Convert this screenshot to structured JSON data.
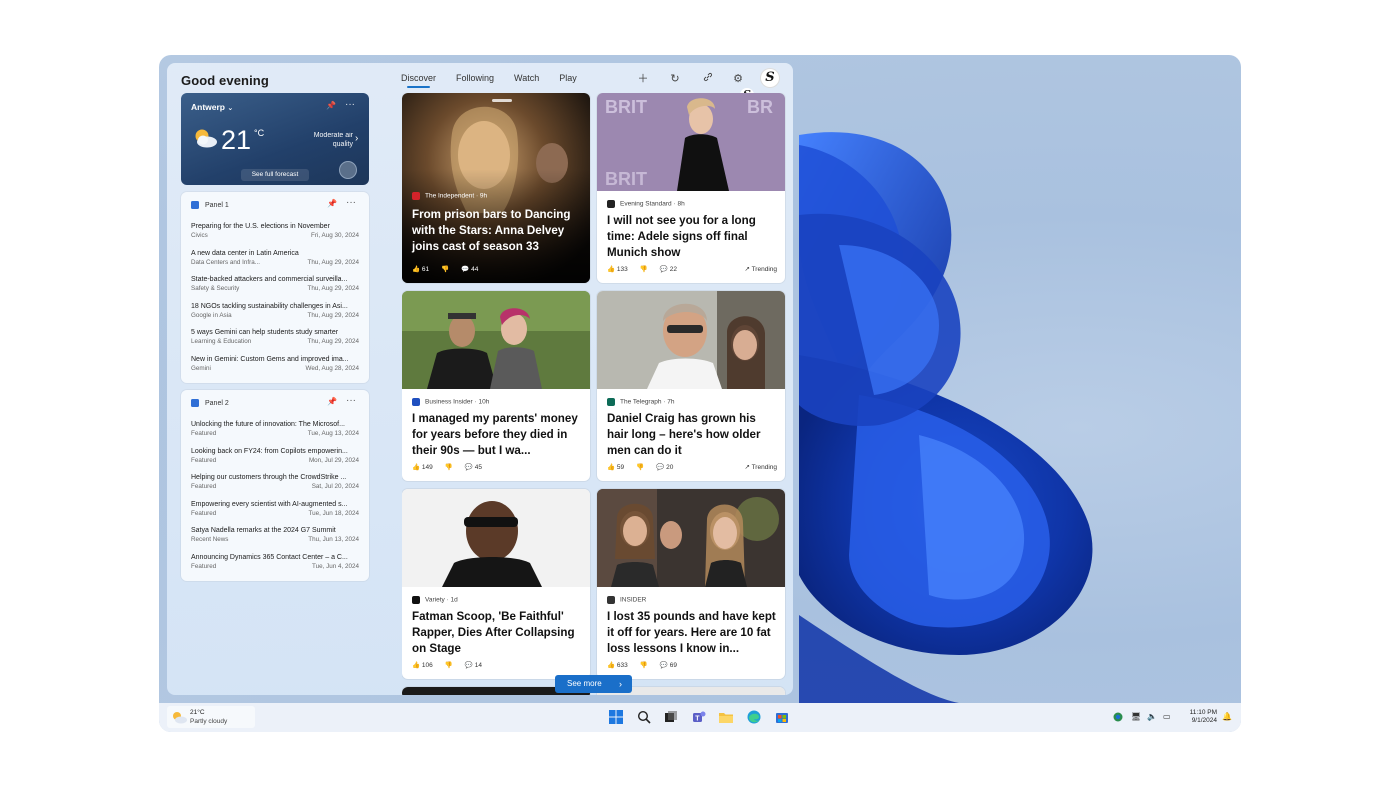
{
  "board": {
    "greeting": "Good evening",
    "tabs": [
      {
        "label": "Discover",
        "active": true
      },
      {
        "label": "Following",
        "active": false
      },
      {
        "label": "Watch",
        "active": false
      },
      {
        "label": "Play",
        "active": false
      }
    ],
    "avatar_letter": "S"
  },
  "weather": {
    "city": "Antwerp",
    "temp": "21",
    "unit": "°C",
    "air_quality": "Moderate air quality",
    "forecast_label": "See full forecast"
  },
  "panels": [
    {
      "title": "Panel 1",
      "items": [
        {
          "title": "Preparing for the U.S. elections in November",
          "category": "Civics",
          "date": "Fri, Aug 30, 2024"
        },
        {
          "title": "A new data center in Latin America",
          "category": "Data Centers and Infra...",
          "date": "Thu, Aug 29, 2024"
        },
        {
          "title": "State-backed attackers and commercial surveilla...",
          "category": "Safety & Security",
          "date": "Thu, Aug 29, 2024"
        },
        {
          "title": "18 NGOs tackling sustainability challenges in Asi...",
          "category": "Google in Asia",
          "date": "Thu, Aug 29, 2024"
        },
        {
          "title": "5 ways Gemini can help students study smarter",
          "category": "Learning & Education",
          "date": "Thu, Aug 29, 2024"
        },
        {
          "title": "New in Gemini: Custom Gems and improved ima...",
          "category": "Gemini",
          "date": "Wed, Aug 28, 2024"
        }
      ]
    },
    {
      "title": "Panel 2",
      "items": [
        {
          "title": "Unlocking the future of innovation: The Microsof...",
          "category": "Featured",
          "date": "Tue, Aug 13, 2024"
        },
        {
          "title": "Looking back on FY24: from Copilots empowerin...",
          "category": "Featured",
          "date": "Mon, Jul 29, 2024"
        },
        {
          "title": "Helping our customers through the CrowdStrike ...",
          "category": "Featured",
          "date": "Sat, Jul 20, 2024"
        },
        {
          "title": "Empowering every scientist with AI-augmented s...",
          "category": "Featured",
          "date": "Tue, Jun 18, 2024"
        },
        {
          "title": "Satya Nadella remarks at the 2024 G7 Summit",
          "category": "Recent News",
          "date": "Thu, Jun 13, 2024"
        },
        {
          "title": "Announcing Dynamics 365 Contact Center – a C...",
          "category": "Featured",
          "date": "Tue, Jun 4, 2024"
        }
      ]
    }
  ],
  "feed": [
    {
      "source": "The Independent · 9h",
      "title": "From prison bars to Dancing with the Stars: Anna Delvey joins cast of season 33",
      "likes": "61",
      "comments": "44",
      "trend": "",
      "icon_color": "#d2232a"
    },
    {
      "source": "Evening Standard · 8h",
      "title": "I will not see you for a long time: Adele signs off final Munich show",
      "likes": "133",
      "comments": "22",
      "trend": "Trending",
      "icon_color": "#222222"
    },
    {
      "source": "Business Insider · 10h",
      "title": "I managed my parents' money for years before they died in their 90s — but I wa...",
      "likes": "149",
      "comments": "45",
      "trend": "",
      "icon_color": "#1f4fbf"
    },
    {
      "source": "The Telegraph · 7h",
      "title": "Daniel Craig has grown his hair long – here's how older men can do it",
      "likes": "59",
      "comments": "20",
      "trend": "Trending",
      "icon_color": "#0d6b57"
    },
    {
      "source": "Variety · 1d",
      "title": "Fatman Scoop, 'Be Faithful' Rapper, Dies After Collapsing on Stage",
      "likes": "106",
      "comments": "14",
      "trend": "",
      "icon_color": "#111111"
    },
    {
      "source": "INSIDER",
      "title": "I lost 35 pounds and have kept it off for years. Here are 10 fat loss lessons I know in...",
      "likes": "633",
      "comments": "69",
      "trend": "",
      "icon_color": "#333333"
    }
  ],
  "see_more": "See more",
  "taskbar": {
    "weather_temp": "21°C",
    "weather_desc": "Partly cloudy",
    "time": "11:10 PM",
    "date": "9/1/2024"
  }
}
